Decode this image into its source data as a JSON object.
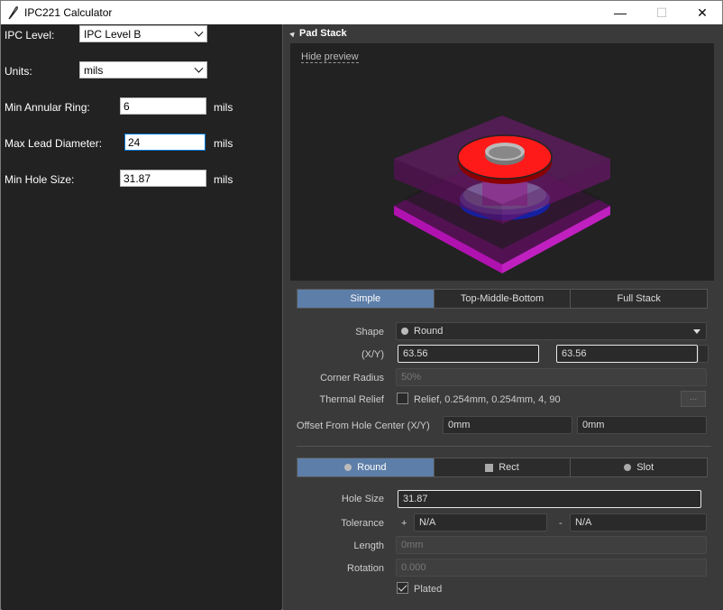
{
  "window": {
    "title": "IPC221 Calculator",
    "min_glyph": "—",
    "max_glyph": "☐",
    "close_glyph": "✕"
  },
  "left": {
    "ipc_level": {
      "label": "IPC Level:",
      "value": "IPC Level B"
    },
    "units": {
      "label": "Units:",
      "value": "mils"
    },
    "min_annular_ring": {
      "label": "Min Annular Ring:",
      "value": "6",
      "unit": "mils"
    },
    "max_lead_diameter": {
      "label": "Max Lead Diameter:",
      "value": "24",
      "unit": "mils"
    },
    "min_hole_size": {
      "label": "Min Hole Size:",
      "value": "31.87",
      "unit": "mils"
    }
  },
  "pad_stack": {
    "header": "Pad Stack",
    "hide_preview": "Hide preview",
    "stack_tabs": [
      "Simple",
      "Top-Middle-Bottom",
      "Full Stack"
    ],
    "active_stack_tab": "Simple",
    "shape_label": "Shape",
    "shape_value": "Round",
    "xy_label": "(X/Y)",
    "x_value": "63.56",
    "y_value": "63.56",
    "corner_radius_label": "Corner Radius",
    "corner_radius_value": "50%",
    "thermal_relief_label": "Thermal Relief",
    "thermal_relief_value": "Relief, 0.254mm, 0.254mm, 4, 90",
    "thermal_relief_checked": false,
    "more_button": "...",
    "offset_label": "Offset From Hole Center (X/Y)",
    "offset_x": "0mm",
    "offset_y": "0mm"
  },
  "hole": {
    "tabs": [
      "Round",
      "Rect",
      "Slot"
    ],
    "active_tab": "Round",
    "hole_size_label": "Hole Size",
    "hole_size_value": "31.87",
    "tolerance_label": "Tolerance",
    "tol_plus_sign": "+",
    "tol_plus": "N/A",
    "tol_minus_sign": "-",
    "tol_minus": "N/A",
    "length_label": "Length",
    "length_value": "0mm",
    "rotation_label": "Rotation",
    "rotation_value": "0.000",
    "plated_label": "Plated",
    "plated_checked": true
  },
  "colors": {
    "accent_tab": "#5d7ea8",
    "pad_red": "#ff1a1a",
    "board_purple": "#8a1a8a"
  }
}
